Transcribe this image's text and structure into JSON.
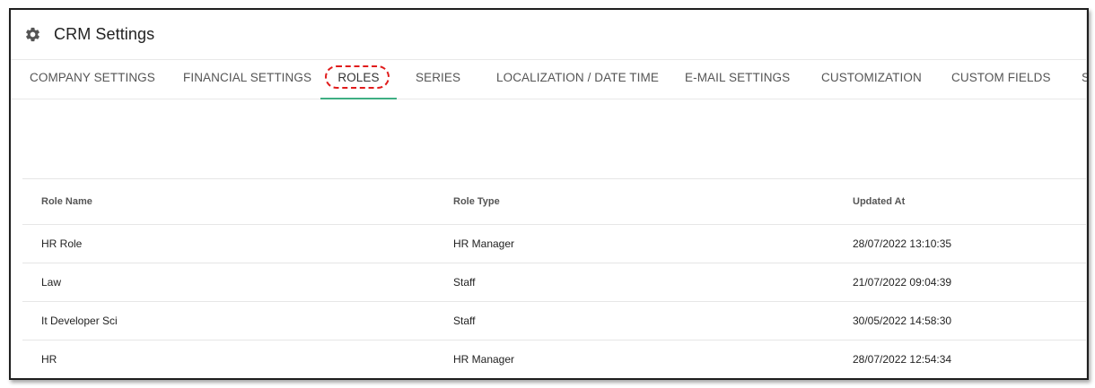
{
  "header": {
    "title": "CRM Settings",
    "icon": "gear-icon"
  },
  "tabs": [
    {
      "label": "COMPANY SETTINGS",
      "active": false
    },
    {
      "label": "FINANCIAL SETTINGS",
      "active": false
    },
    {
      "label": "ROLES",
      "active": true
    },
    {
      "label": "SERIES",
      "active": false
    },
    {
      "label": "LOCALIZATION / DATE TIME",
      "active": false
    },
    {
      "label": "E-MAIL SETTINGS",
      "active": false
    },
    {
      "label": "CUSTOMIZATION",
      "active": false
    },
    {
      "label": "CUSTOM FIELDS",
      "active": false
    },
    {
      "label": "S",
      "active": false
    }
  ],
  "table": {
    "columns": [
      "Role Name",
      "Role Type",
      "Updated At"
    ],
    "rows": [
      {
        "name": "HR Role",
        "type": "HR Manager",
        "updated": "28/07/2022 13:10:35"
      },
      {
        "name": "Law",
        "type": "Staff",
        "updated": "21/07/2022 09:04:39"
      },
      {
        "name": "It Developer Sci",
        "type": "Staff",
        "updated": "30/05/2022 14:58:30"
      },
      {
        "name": "HR",
        "type": "HR Manager",
        "updated": "28/07/2022 12:54:34"
      }
    ]
  },
  "colors": {
    "accent": "#3fae83",
    "annotation": "#e01b1b"
  }
}
